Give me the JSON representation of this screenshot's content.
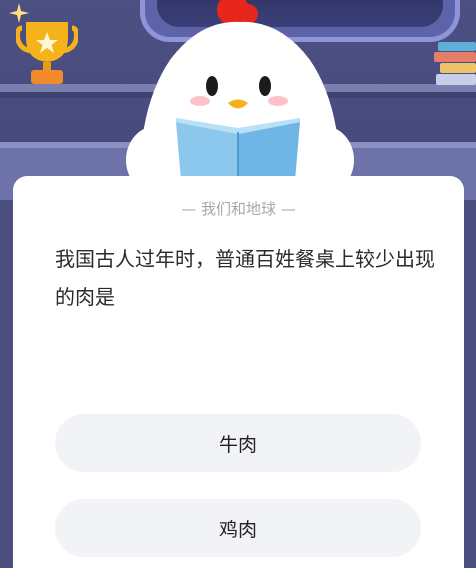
{
  "quiz": {
    "category": "— 我们和地球 —",
    "question": "我国古人过年时，普通百姓餐桌上较少出现的肉是",
    "options": [
      {
        "label": "牛肉"
      },
      {
        "label": "鸡肉"
      }
    ]
  },
  "illustration": {
    "trophy_icon": "trophy-icon",
    "sparkle_icon": "sparkle-icon",
    "mascot": "chick-mascot-reading-book",
    "books_icon": "book-stack-icon"
  },
  "colors": {
    "background": "#4b4f82",
    "card": "#ffffff",
    "option_bg": "#f1f3f6",
    "trophy": "#f5b21a",
    "comb": "#e8261c"
  }
}
